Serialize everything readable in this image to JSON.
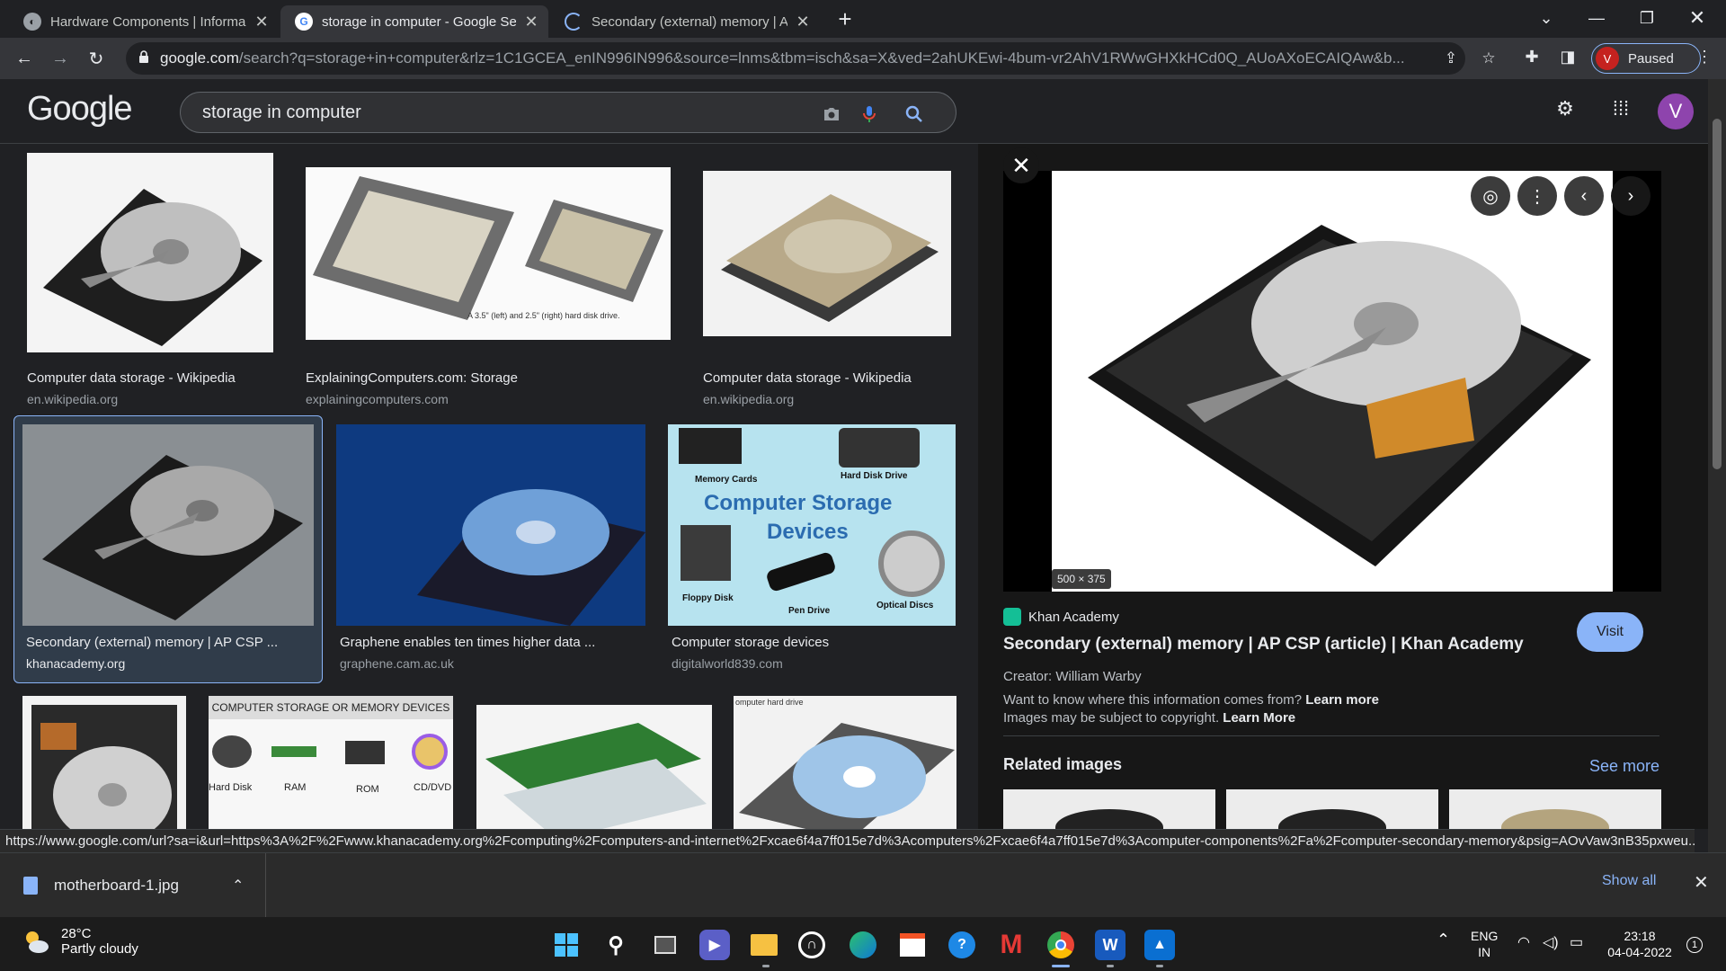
{
  "browser": {
    "tabs": [
      {
        "title": "Hardware Components | Informa",
        "active": false
      },
      {
        "title": "storage in computer - Google Se",
        "active": true
      },
      {
        "title": "Secondary (external) memory | Al",
        "active": false
      }
    ],
    "url_host": "google.com",
    "url_rest": "/search?q=storage+in+computer&rlz=1C1GCEA_enIN996IN996&source=lnms&tbm=isch&sa=X&ved=2ahUKEwi-4bum-vr2AhV1RWwGHXkHCd0Q_AUoAXoECAIQAw&b...",
    "profile_initial": "V",
    "profile_status": "Paused"
  },
  "google": {
    "logo": "Google",
    "query": "storage in computer",
    "account_initial": "V"
  },
  "results": [
    {
      "caption": "Computer data storage - Wikipedia",
      "source": "en.wikipedia.org"
    },
    {
      "caption": "ExplainingComputers.com: Storage",
      "source": "explainingcomputers.com",
      "image_text": "A 3.5\" (left) and 2.5\" (right) hard disk drive."
    },
    {
      "caption": "Computer data storage - Wikipedia",
      "source": "en.wikipedia.org"
    },
    {
      "caption": "Secondary (external) memory | AP CSP ...",
      "source": "khanacademy.org"
    },
    {
      "caption": "Graphene enables ten times higher data ...",
      "source": "graphene.cam.ac.uk"
    },
    {
      "caption": "Computer storage devices",
      "source": "digitalworld839.com",
      "image_text": {
        "title1": "Computer Storage",
        "title2": "Devices",
        "memory_cards": "Memory Cards",
        "hdd": "Hard Disk Drive",
        "floppy": "Floppy Disk",
        "pen": "Pen Drive",
        "optical": "Optical Discs"
      }
    },
    {
      "caption": "",
      "source": ""
    },
    {
      "caption": "",
      "source": "",
      "image_text": {
        "header": "COMPUTER STORAGE OR MEMORY DEVICES",
        "l1": "Hard Disk",
        "l2": "RAM",
        "l3": "ROM",
        "l4": "CD/DVD"
      }
    },
    {
      "caption": "",
      "source": ""
    },
    {
      "caption": "",
      "source": "",
      "image_text": {
        "header": "omputer hard drive"
      }
    }
  ],
  "panel": {
    "dimensions": "500 × 375",
    "source_name": "Khan Academy",
    "title": "Secondary (external) memory | AP CSP (article) | Khan Academy",
    "visit_label": "Visit",
    "creator": "Creator: William Warby",
    "info_q": "Want to know where this information comes from?",
    "learn_more_1": "Learn more",
    "copyright": "Images may be subject to copyright.",
    "learn_more_2": "Learn More",
    "related": "Related images",
    "see_more": "See more"
  },
  "status_url": "https://www.google.com/url?sa=i&url=https%3A%2F%2Fwww.khanacademy.org%2Fcomputing%2Fcomputers-and-internet%2Fxcae6f4a7ff015e7d%3Acomputers%2Fxcae6f4a7ff015e7d%3Acomputer-components%2Fa%2Fcomputer-secondary-memory&psig=AOvVaw3nB35pxweu...",
  "download": {
    "file": "motherboard-1.jpg",
    "show_all": "Show all"
  },
  "taskbar": {
    "temp": "28°C",
    "weather": "Partly cloudy",
    "lang1": "ENG",
    "lang2": "IN",
    "time": "23:18",
    "date": "04-04-2022",
    "notif_count": "1"
  },
  "colors": {
    "accent": "#8ab4f8",
    "bg": "#202124",
    "panel_bg": "#171717"
  }
}
